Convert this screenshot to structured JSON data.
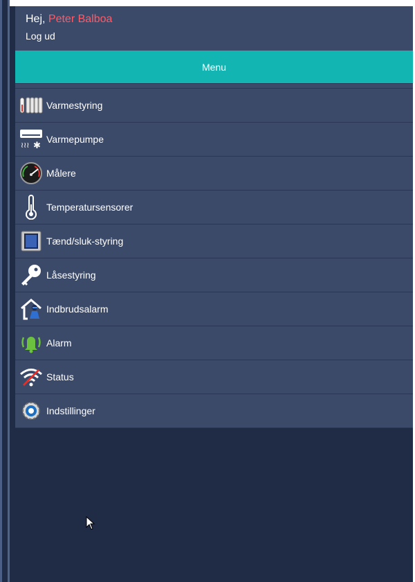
{
  "header": {
    "greeting": "Hej,",
    "user_name": "Peter Balboa",
    "logout_label": "Log ud"
  },
  "menu": {
    "title": "Menu",
    "items": [
      {
        "label": "Varmestyring",
        "icon": "radiator-icon"
      },
      {
        "label": "Varmepumpe",
        "icon": "heat-pump-icon"
      },
      {
        "label": "Målere",
        "icon": "gauge-icon"
      },
      {
        "label": "Temperatursensorer",
        "icon": "thermometer-icon"
      },
      {
        "label": "Tænd/sluk-styring",
        "icon": "switch-panel-icon"
      },
      {
        "label": "Låsestyring",
        "icon": "key-icon"
      },
      {
        "label": "Indbrudsalarm",
        "icon": "burglar-house-icon"
      },
      {
        "label": "Alarm",
        "icon": "alarm-bell-icon"
      },
      {
        "label": "Status",
        "icon": "wifi-off-icon"
      },
      {
        "label": "Indstillinger",
        "icon": "settings-gear-icon"
      }
    ]
  },
  "colors": {
    "background": "#202b46",
    "panel": "#3c4a6a",
    "accent": "#13b5b3",
    "user_name": "#ff5a66"
  }
}
